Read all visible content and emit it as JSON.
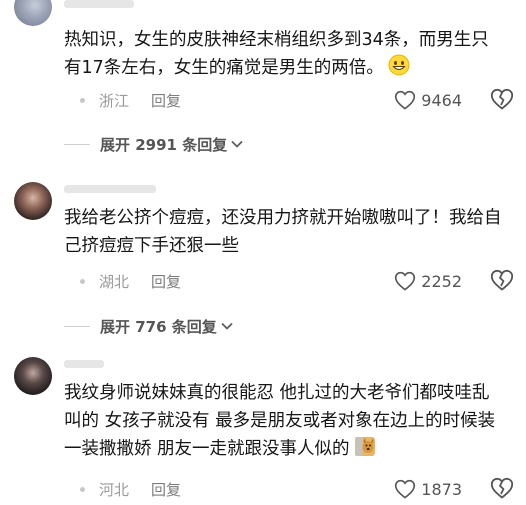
{
  "comments": [
    {
      "text": "热知识，女生的皮肤神经末梢组织多到34条，而男生只有17条左右，女生的痛觉是男生的两倍。",
      "location": "浙江",
      "reply_label": "回复",
      "likes": "9464",
      "emoji": "smiling-face-emoji"
    },
    {
      "text": "我给老公挤个痘痘，还没用力挤就开始嗷嗷叫了！我给自己挤痘痘下手还狠一些",
      "location": "湖北",
      "reply_label": "回复",
      "likes": "2252"
    },
    {
      "text": "我纹身师说妹妹真的很能忍 他扎过的大老爷们都吱哇乱叫的 女孩子就没有 最多是朋友或者对象在边上的时候装一装撒撒娇 朋友一走就跟没事人似的",
      "location": "河北",
      "reply_label": "回复",
      "likes": "1873",
      "emoji": "dog-peeking-emoji"
    }
  ],
  "expand_replies": [
    {
      "label": "展开 2991 条回复"
    },
    {
      "label": "展开 776 条回复"
    }
  ],
  "icons": {
    "like": "heart-outline-icon",
    "dislike": "broken-heart-outline-icon",
    "expand": "chevron-down-icon"
  },
  "colors": {
    "text": "#161616",
    "muted": "#9a9a9a",
    "background": "#ffffff"
  }
}
